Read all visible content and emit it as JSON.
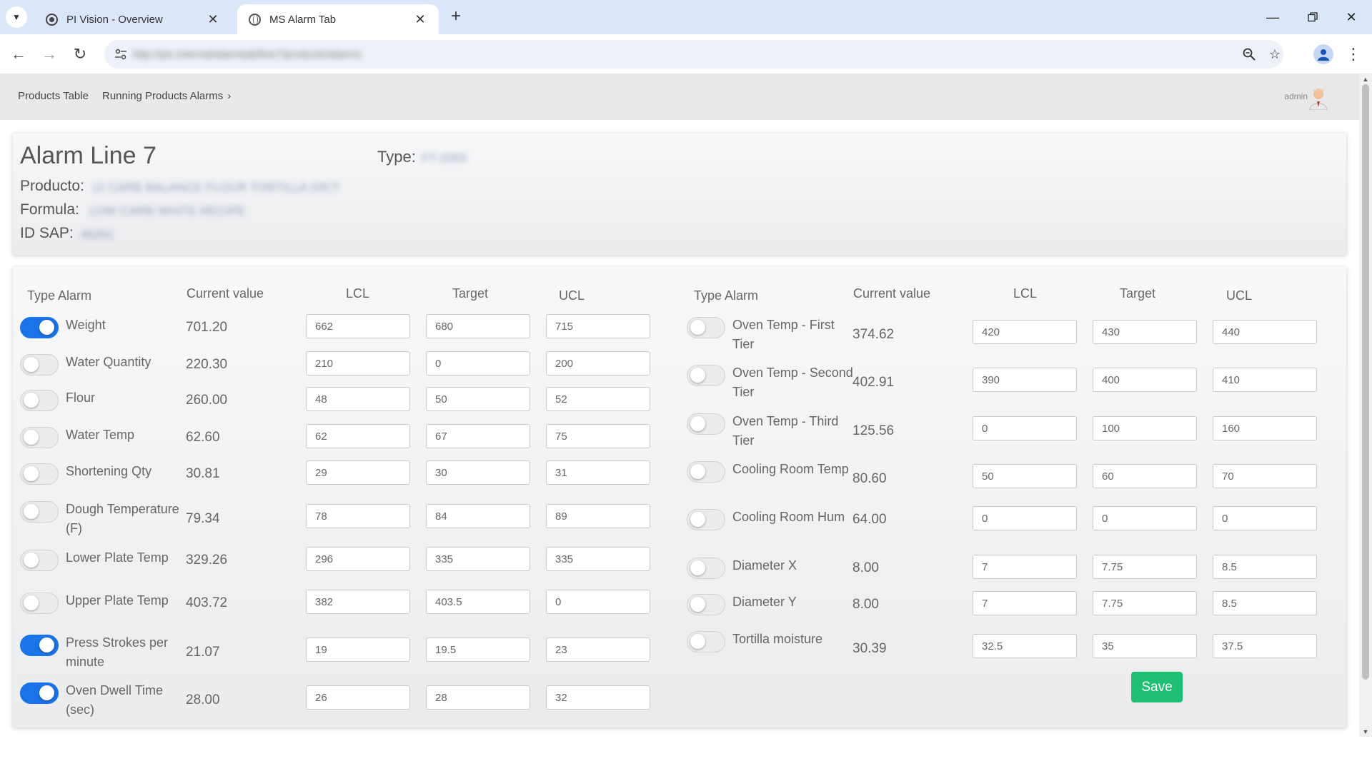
{
  "browser": {
    "tabs": [
      {
        "title": "PI Vision - Overview",
        "active": false
      },
      {
        "title": "MS Alarm Tab",
        "active": true
      }
    ],
    "url": "http://pis.internal/alarmtab/line7/products/alarms"
  },
  "header": {
    "breadcrumbs": [
      "Products Table",
      "Running Products Alarms"
    ],
    "user": "admin"
  },
  "info": {
    "title": "Alarm Line 7",
    "type_label": "Type:",
    "type_value": "FT-2000",
    "producto_label": "Producto:",
    "producto_value": "12 CARB BALANCE FLOUR TORTILLA 20CT",
    "formula_label": "Formula:",
    "formula_value": "LOW CARB WHITE RECIPE",
    "id_sap_label": "ID SAP:",
    "id_sap_value": "48291"
  },
  "columns": {
    "type_alarm": "Type Alarm",
    "current_value": "Current value",
    "lcl": "LCL",
    "target": "Target",
    "ucl": "UCL"
  },
  "alarms_left": [
    {
      "label": "Weight",
      "enabled": true,
      "current": "701.20",
      "lcl": "662",
      "target": "680",
      "ucl": "715"
    },
    {
      "label": "Water Quantity",
      "enabled": false,
      "current": "220.30",
      "lcl": "210",
      "target": "0",
      "ucl": "200"
    },
    {
      "label": "Flour",
      "enabled": false,
      "current": "260.00",
      "lcl": "48",
      "target": "50",
      "ucl": "52"
    },
    {
      "label": "Water Temp",
      "enabled": false,
      "current": "62.60",
      "lcl": "62",
      "target": "67",
      "ucl": "75"
    },
    {
      "label": "Shortening Qty",
      "enabled": false,
      "current": "30.81",
      "lcl": "29",
      "target": "30",
      "ucl": "31"
    },
    {
      "label": "Dough Temperature (F)",
      "enabled": false,
      "current": "79.34",
      "lcl": "78",
      "target": "84",
      "ucl": "89"
    },
    {
      "label": "Lower Plate Temp",
      "enabled": false,
      "current": "329.26",
      "lcl": "296",
      "target": "335",
      "ucl": "335"
    },
    {
      "label": "Upper Plate Temp",
      "enabled": false,
      "current": "403.72",
      "lcl": "382",
      "target": "403.5",
      "ucl": "0"
    },
    {
      "label": "Press Strokes per minute",
      "enabled": true,
      "current": "21.07",
      "lcl": "19",
      "target": "19.5",
      "ucl": "23"
    },
    {
      "label": "Oven Dwell Time (sec)",
      "enabled": true,
      "current": "28.00",
      "lcl": "26",
      "target": "28",
      "ucl": "32"
    }
  ],
  "alarms_right": [
    {
      "label": "Oven Temp - First Tier",
      "enabled": false,
      "current": "374.62",
      "lcl": "420",
      "target": "430",
      "ucl": "440"
    },
    {
      "label": "Oven Temp - Second Tier",
      "enabled": false,
      "current": "402.91",
      "lcl": "390",
      "target": "400",
      "ucl": "410"
    },
    {
      "label": "Oven Temp - Third Tier",
      "enabled": false,
      "current": "125.56",
      "lcl": "0",
      "target": "100",
      "ucl": "160"
    },
    {
      "label": "Cooling Room Temp",
      "enabled": false,
      "current": "80.60",
      "lcl": "50",
      "target": "60",
      "ucl": "70"
    },
    {
      "label": "Cooling Room Hum",
      "enabled": false,
      "current": "64.00",
      "lcl": "0",
      "target": "0",
      "ucl": "0"
    },
    {
      "label": "Diameter X",
      "enabled": false,
      "current": "8.00",
      "lcl": "7",
      "target": "7.75",
      "ucl": "8.5"
    },
    {
      "label": "Diameter Y",
      "enabled": false,
      "current": "8.00",
      "lcl": "7",
      "target": "7.75",
      "ucl": "8.5"
    },
    {
      "label": "Tortilla moisture",
      "enabled": false,
      "current": "30.39",
      "lcl": "32.5",
      "target": "35",
      "ucl": "37.5"
    }
  ],
  "save_label": "Save",
  "colors": {
    "toggle_on": "#1a73e8",
    "save_button": "#1fbf73",
    "header_bg": "#e8e8e8"
  }
}
